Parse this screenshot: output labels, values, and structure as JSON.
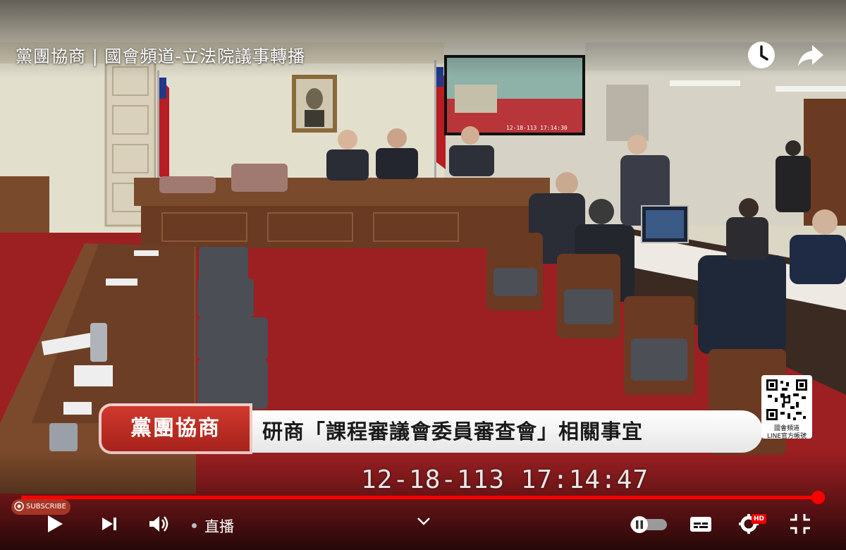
{
  "player": {
    "title": "黨團協商 | 國會頻道-立法院議事轉播",
    "icons": {
      "watch_later": "clock-icon",
      "share": "share-icon"
    }
  },
  "overlay": {
    "tag": "黨團協商",
    "headline": "研商「課程審議會委員審查會」相關事宜",
    "timestamp": "12-18-113   17:14:47",
    "qr_label_line1": "國會頻道",
    "qr_label_line2": "LINE官方帳號",
    "screen_timestamp": "12-18-113 17:14:30"
  },
  "controls": {
    "subscribe": "SUBSCRIBE",
    "live_label": "直播",
    "hd": "HD",
    "progress": 0.991,
    "icons": [
      "play-icon",
      "next-icon",
      "volume-icon",
      "chevron-down-icon",
      "autoplay-toggle-icon",
      "subtitles-icon",
      "settings-icon",
      "exit-fullscreen-icon"
    ]
  },
  "colors": {
    "progress": "#ff0000",
    "tag_red": "#c0291f",
    "carpet": "#9c1f22",
    "wood": "#6a3a22"
  }
}
